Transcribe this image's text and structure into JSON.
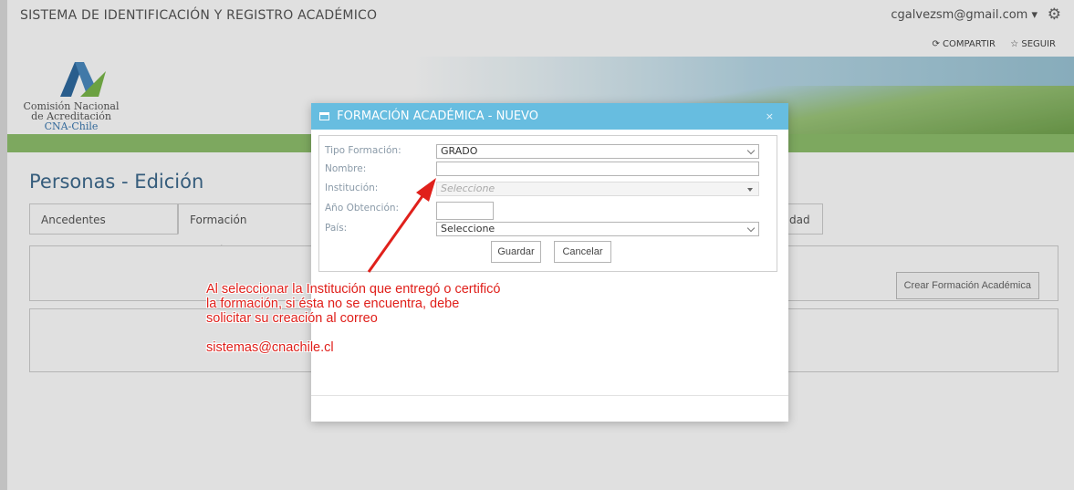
{
  "app": {
    "title": "SISTEMA DE IDENTIFICACIÓN Y REGISTRO ACADÉMICO",
    "user": "cgalvezsm@gmail.com ▾",
    "share": "COMPARTIR",
    "follow": "SEGUIR"
  },
  "logo": {
    "line1": "Comisión Nacional",
    "line2": "de Acreditación",
    "line3": "CNA-Chile"
  },
  "page": {
    "title": "Personas - Edición",
    "tabs": [
      "Ancedentes Personales",
      "Formación Académica",
      "dad"
    ],
    "create_button": "Crear Formación Académica"
  },
  "modal": {
    "title": "FORMACIÓN ACADÉMICA - NUEVO",
    "close": "×",
    "fields": {
      "tipo_label": "Tipo Formación:",
      "tipo_value": "GRADO",
      "nombre_label": "Nombre:",
      "nombre_value": "",
      "institucion_label": "Institución:",
      "institucion_placeholder": "Seleccione",
      "anio_label": "Año Obtención:",
      "anio_value": "",
      "pais_label": "País:",
      "pais_value": "Seleccione"
    },
    "save": "Guardar",
    "cancel": "Cancelar"
  },
  "annotation": {
    "text": "Al seleccionar la Institución que entregó o certificó la formación, si ésta no se encuentra, debe solicitar su creación al correo",
    "email": "sistemas@cnachile.cl",
    "color": "#e0201b"
  },
  "colors": {
    "modal_header": "#67bde0",
    "title_blue": "#3e6a8e",
    "banner_green": "#8fc06d"
  }
}
